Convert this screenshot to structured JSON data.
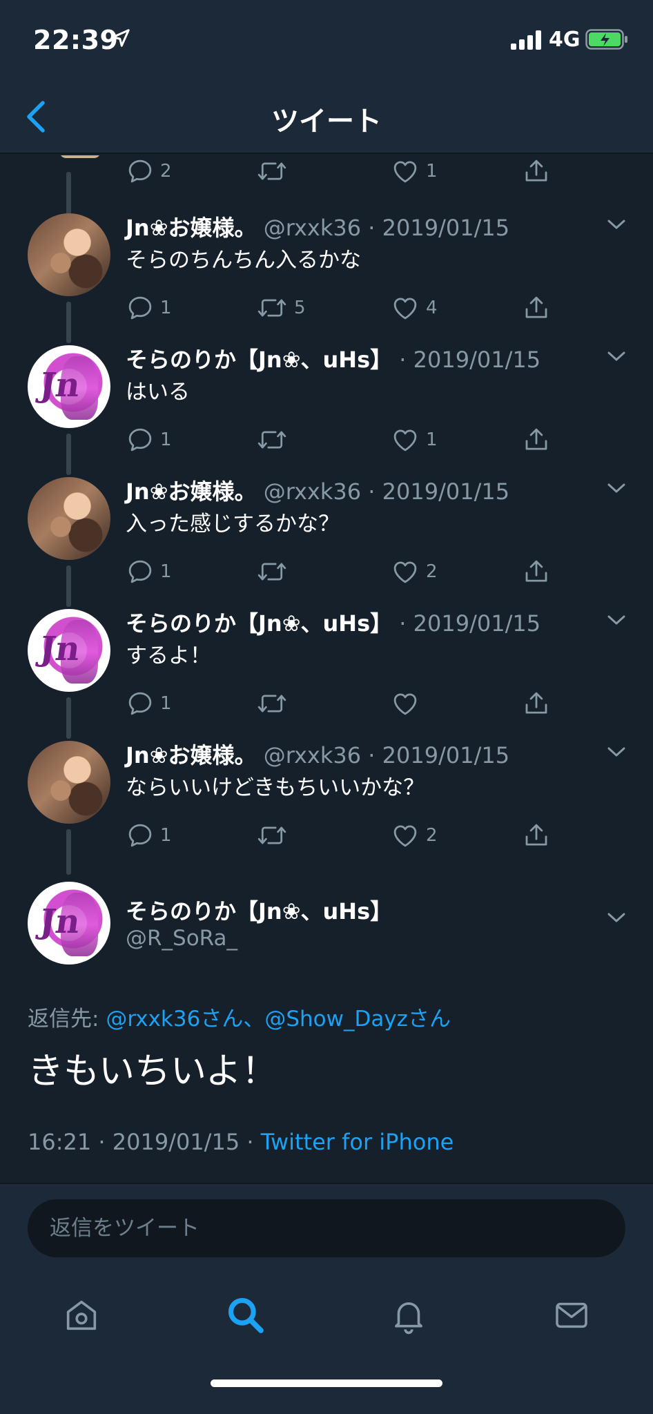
{
  "status_bar": {
    "time": "22:39",
    "network": "4G"
  },
  "nav": {
    "title": "ツイート"
  },
  "tweets": [
    {
      "avatar": "jn",
      "name": "Jn❀お嬢様。",
      "meta": "@rxxk36 · 2019/01/15",
      "text": "そらのちんちん入るかな",
      "counts": {
        "reply": "1",
        "retweet": "5",
        "like": "4"
      }
    },
    {
      "avatar": "sora",
      "name": "そらのりか【Jn❀、uHs】",
      "meta": " · 2019/01/15",
      "text": "はいる",
      "counts": {
        "reply": "1",
        "retweet": "",
        "like": "1"
      }
    },
    {
      "avatar": "jn",
      "name": "Jn❀お嬢様。",
      "meta": "@rxxk36 · 2019/01/15",
      "text": "入った感じするかな？",
      "counts": {
        "reply": "1",
        "retweet": "",
        "like": "2"
      }
    },
    {
      "avatar": "sora",
      "name": "そらのりか【Jn❀、uHs】",
      "meta": " · 2019/01/15",
      "text": "するよ！",
      "counts": {
        "reply": "1",
        "retweet": "",
        "like": ""
      }
    },
    {
      "avatar": "jn",
      "name": "Jn❀お嬢様。",
      "meta": "@rxxk36 · 2019/01/15",
      "text": "ならいいけどきもちいいかな？",
      "counts": {
        "reply": "1",
        "retweet": "",
        "like": "2"
      }
    }
  ],
  "top_partial_actions": {
    "reply": "2",
    "retweet": "",
    "like": "1"
  },
  "main_tweet": {
    "name": "そらのりか【Jn❀、uHs】",
    "handle": "@R_SoRa_",
    "reply_label": "返信先: ",
    "reply_targets": "@rxxk36さん、@Show_Dayzさん",
    "text": "きもいちいよ！",
    "time": "16:21 · 2019/01/15 · ",
    "source": "Twitter for iPhone"
  },
  "composer": {
    "placeholder": "返信をツイート"
  },
  "tabs": [
    {
      "icon": "home-icon"
    },
    {
      "icon": "search-icon"
    },
    {
      "icon": "bell-icon"
    },
    {
      "icon": "mail-icon"
    }
  ],
  "colors": {
    "background": "#15202b",
    "bar": "#1c2938",
    "accent": "#1da1f2",
    "muted": "#8899a6"
  }
}
